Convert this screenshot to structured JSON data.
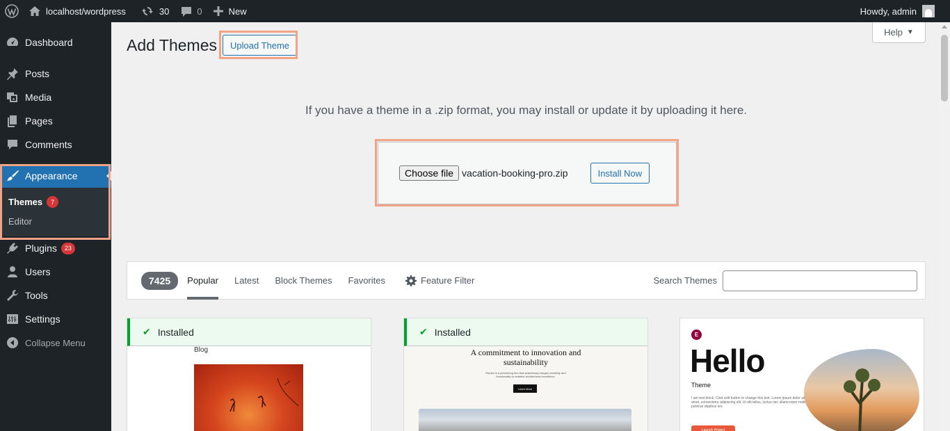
{
  "adminbar": {
    "site_name": "localhost/wordpress",
    "updates_count": "30",
    "comments_count": "0",
    "new_label": "New",
    "howdy": "Howdy, admin"
  },
  "sidebar": {
    "items": [
      {
        "label": "Dashboard"
      },
      {
        "label": "Posts"
      },
      {
        "label": "Media"
      },
      {
        "label": "Pages"
      },
      {
        "label": "Comments"
      },
      {
        "label": "Appearance"
      },
      {
        "label": "Plugins",
        "badge": "23"
      },
      {
        "label": "Users"
      },
      {
        "label": "Tools"
      },
      {
        "label": "Settings"
      },
      {
        "label": "Collapse Menu"
      }
    ],
    "submenu": [
      {
        "label": "Themes",
        "badge": "7"
      },
      {
        "label": "Editor"
      }
    ]
  },
  "main": {
    "title": "Add Themes",
    "upload_button": "Upload Theme",
    "help_label": "Help",
    "upload_description": "If you have a theme in a .zip format, you may install or update it by uploading it here.",
    "choose_file_label": "Choose file",
    "file_name": "vacation-booking-pro.zip",
    "install_button": "Install Now"
  },
  "filter": {
    "count": "7425",
    "tabs": [
      {
        "label": "Popular"
      },
      {
        "label": "Latest"
      },
      {
        "label": "Block Themes"
      },
      {
        "label": "Favorites"
      }
    ],
    "feature_filter": "Feature Filter",
    "search_label": "Search Themes",
    "search_value": ""
  },
  "themes": [
    {
      "status": "Installed",
      "preview_heading": "Blog"
    },
    {
      "status": "Installed",
      "preview_heading": "A commitment to innovation and sustainability",
      "preview_text": "Études is a pioneering firm that seamlessly merges creativity and functionality to redefine architectural excellence.",
      "preview_button": "Learn More"
    },
    {
      "status": "",
      "preview_heading": "Hello",
      "preview_sub": "Theme",
      "preview_text": "I am text block. Click edit button to change this text. Lorem ipsum dolor sit amet, consectetur adipiscing elit. Ut elit tellus, luctus nec ullamcorper mattis, pulvinar dapibus leo.",
      "preview_button": "Launch Project"
    }
  ],
  "colors": {
    "accent": "#2271b1",
    "admin_bg": "#1d2327",
    "badge": "#d63638",
    "installed": "#00a32a",
    "highlight": "#f0a485"
  }
}
